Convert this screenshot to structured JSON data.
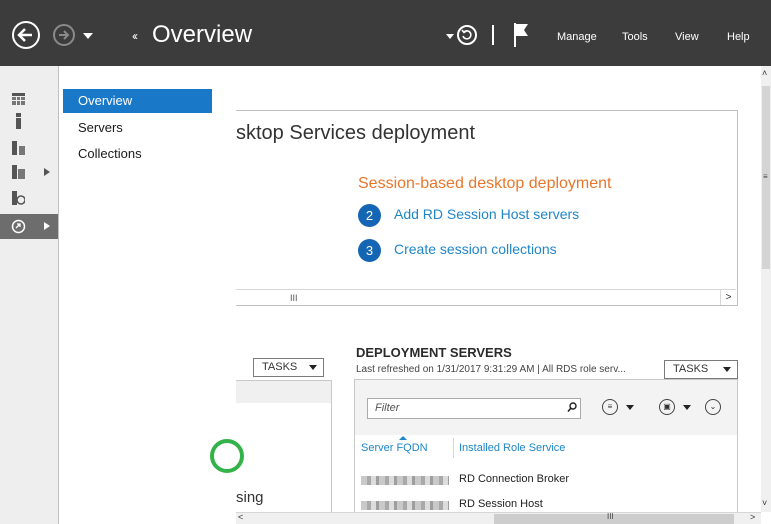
{
  "titlebar": {
    "breadcrumb_arrows": "‹‹",
    "title": "Overview",
    "menu": [
      "Manage",
      "Tools",
      "View",
      "Help"
    ]
  },
  "nav": {
    "items": [
      {
        "label": "Overview",
        "active": true
      },
      {
        "label": "Servers",
        "active": false
      },
      {
        "label": "Collections",
        "active": false
      }
    ]
  },
  "quick_start": {
    "title": "sktop Services deployment",
    "subtitle": "Session-based desktop deployment",
    "steps": [
      {
        "num": "2",
        "label": "Add RD Session Host servers"
      },
      {
        "num": "3",
        "label": "Create session collections"
      }
    ],
    "scroll_grip": "III"
  },
  "left_tile": {
    "tasks_label": "TASKS",
    "partial_text": "sing"
  },
  "deployment_servers": {
    "title": "DEPLOYMENT SERVERS",
    "meta": "Last refreshed on 1/31/2017 9:31:29 AM | All RDS role serv...",
    "tasks_label": "TASKS",
    "filter_placeholder": "Filter",
    "columns": [
      "Server FQDN",
      "Installed Role Service"
    ],
    "rows": [
      {
        "role": "RD Connection Broker"
      },
      {
        "role": "RD Session Host"
      }
    ]
  },
  "bottom_scroll_grip": "III",
  "colors": {
    "titlebar": "#3c3c3c",
    "accent": "#1a78c8",
    "link": "#1f86c8",
    "orange": "#e8762b",
    "step_circle": "#1565b5",
    "status_green": "#34b24a"
  }
}
